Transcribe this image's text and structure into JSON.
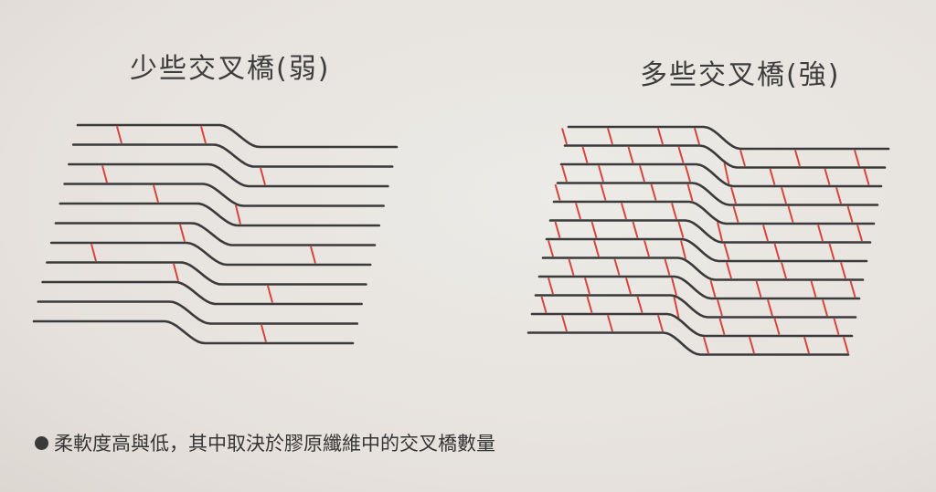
{
  "titles": {
    "left": "少些交叉橋(弱)",
    "right": "多些交叉橋(強)"
  },
  "caption": {
    "text": "柔軟度高與低，其中取決於膠原纖維中的交叉橋數量"
  },
  "colors": {
    "fiber": "#3a3a3a",
    "crosslink": "#d9443a",
    "background": "#e9e5e1"
  },
  "diagram": {
    "left_crosslink_count": 14,
    "right_crosslink_count": 84
  }
}
